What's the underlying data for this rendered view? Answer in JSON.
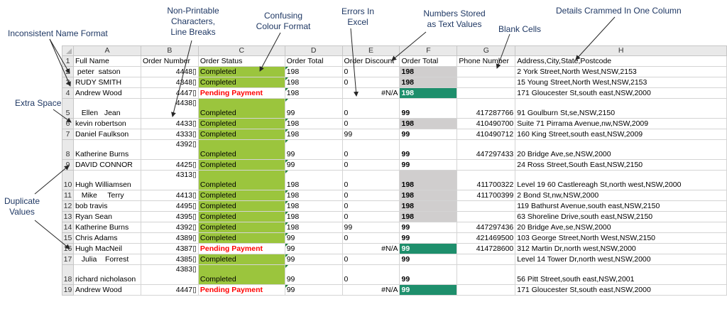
{
  "annotations": {
    "inconsistent_name": "Inconsistent Name Format",
    "non_printable": [
      "Non-Printable",
      "Characters,",
      "Line Breaks"
    ],
    "confusing_colour": [
      "Confusing",
      "Colour Format"
    ],
    "errors_in_excel": [
      "Errors In",
      "Excel"
    ],
    "numbers_as_text": [
      "Numbers Stored",
      "as Text Values"
    ],
    "blank_cells": "Blank Cells",
    "details_crammed": "Details Crammed In One Column",
    "extra_spaces": "Extra Spaces",
    "duplicate_values": [
      "Duplicate",
      "Values"
    ]
  },
  "sheet": {
    "column_letters": [
      "A",
      "B",
      "C",
      "D",
      "E",
      "F",
      "G",
      "H"
    ],
    "header_row_number": "1",
    "headers": [
      "Full Name",
      "Order Number",
      "Order Status",
      "Order Total",
      "Order Discount",
      "Order Total",
      "Phone Number",
      "Address,City,State,Postcode"
    ],
    "rows": [
      {
        "n": "2",
        "name": " peter  satson",
        "order": "4448▯",
        "status": "Completed",
        "total": "198",
        "disc": "0",
        "total2": "198",
        "phone": "",
        "addr": "2 York Street,North West,NSW,2153",
        "style": "grey"
      },
      {
        "n": "3",
        "name": "RUDY SMITH",
        "order": "4348▯",
        "status": "Completed",
        "total": "198",
        "disc": "0",
        "total2": "198",
        "phone": "",
        "addr": "15 Young Street,North West,NSW,2153",
        "style": "grey"
      },
      {
        "n": "4",
        "name": "Andrew Wood",
        "order": "4447▯",
        "status": "Pending Payment",
        "total": "198",
        "disc": "#N/A",
        "total2": "198",
        "phone": "",
        "addr": "171 Gloucester St,south east,NSW,2000",
        "style": "teal"
      },
      {
        "n": "5",
        "name": "   Ellen   Jean",
        "order": "4438▯",
        "status": "Completed",
        "total": "99",
        "disc": "0",
        "total2": "99",
        "phone": "417287766",
        "addr": "91 Goulburn St,se,NSW,2150",
        "style": "white",
        "tall": true
      },
      {
        "n": "6",
        "name": "kevin robertson",
        "order": "   4433▯",
        "status": "Completed",
        "total": "198",
        "disc": "0",
        "total2": "198",
        "phone": "410490700",
        "addr": "Suite 71 Pirrama Avenue,nw,NSW,2009",
        "style": "grey"
      },
      {
        "n": "7",
        "name": "Daniel Faulkson",
        "order": "     4333▯",
        "status": "Completed",
        "total": "198",
        "disc": "99",
        "total2": "99",
        "phone": "410490712",
        "addr": "160 King Street,south east,NSW,2009",
        "style": "white"
      },
      {
        "n": "8",
        "name": "Katherine Burns",
        "order": "4392▯",
        "status": "Completed",
        "total": "99",
        "disc": "0",
        "total2": "99",
        "phone": "447297433",
        "addr": "20 Bridge Ave,se,NSW,2000",
        "style": "white",
        "tall": true
      },
      {
        "n": "9",
        "name": "DAVID CONNOR",
        "order": "   4425▯",
        "status": "Completed",
        "total": "99",
        "disc": "0",
        "total2": "99",
        "phone": "",
        "addr": "24 Ross Street,South East,NSW,2150",
        "style": "white"
      },
      {
        "n": "10",
        "name": "Hugh Williamsen",
        "order": "4313▯",
        "status": "Completed",
        "total": "198",
        "disc": "0",
        "total2": "198",
        "phone": "411700322",
        "addr": "Level 19 60 Castlereagh St,north west,NSW,2000",
        "style": "grey",
        "tall": true
      },
      {
        "n": "11",
        "name": "   Mike     Terry",
        "order": "     4413▯",
        "status": "Completed",
        "total": "198",
        "disc": "0",
        "total2": "198",
        "phone": "411700399",
        "addr": "2 Bond St,nw,NSW,2000",
        "style": "grey"
      },
      {
        "n": "12",
        "name": "bob travis",
        "order": "   4495▯",
        "status": "Completed",
        "total": "198",
        "disc": "0",
        "total2": "198",
        "phone": "",
        "addr": "119 Bathurst Avenue,south east,NSW,2150",
        "style": "grey"
      },
      {
        "n": "13",
        "name": "Ryan Sean",
        "order": "   4395▯",
        "status": "Completed",
        "total": "198",
        "disc": "0",
        "total2": "198",
        "phone": "",
        "addr": "63 Shoreline Drive,south east,NSW,2150",
        "style": "grey"
      },
      {
        "n": "14",
        "name": "Katherine Burns",
        "order": "     4392▯",
        "status": "Completed",
        "total": "198",
        "disc": "99",
        "total2": "99",
        "phone": "447297436",
        "addr": "20 Bridge Ave,se,NSW,2000",
        "style": "white"
      },
      {
        "n": "15",
        "name": "Chris Adams",
        "order": "   4389▯",
        "status": "Completed",
        "total": "99",
        "disc": "0",
        "total2": "99",
        "phone": "421469500",
        "addr": "103 George Street,North West,NSW,2150",
        "style": "white"
      },
      {
        "n": "16",
        "name": "Hugh MacNeil",
        "order": "       4387▯",
        "status": "Pending Payment",
        "total": "99",
        "disc": "#N/A",
        "total2": "99",
        "phone": "414728600",
        "addr": "312 Martin Dr,north west,NSW,2000",
        "style": "teal"
      },
      {
        "n": "17",
        "name": "   Julia    Forrest",
        "order": "   4385▯",
        "status": "Completed",
        "total": "99",
        "disc": "0",
        "total2": "99",
        "phone": "",
        "addr": "Level 14 Tower Dr,north west,NSW,2000",
        "style": "white"
      },
      {
        "n": "18",
        "name": "richard nicholason",
        "order": "4383▯",
        "status": "Completed",
        "total": "99",
        "disc": "0",
        "total2": "99",
        "phone": "",
        "addr": "56 Pitt Street,south east,NSW,2001",
        "style": "white",
        "tall": true
      },
      {
        "n": "19",
        "name": "Andrew Wood",
        "order": "   4447▯",
        "status": "Pending Payment",
        "total": "99",
        "disc": "#N/A",
        "total2": "99",
        "phone": "",
        "addr": "171 Gloucester St,south east,NSW,2000",
        "style": "teal"
      }
    ]
  },
  "colors": {
    "completed": "#9bc53d",
    "pending_text": "#ff0000",
    "highlight_grey": "#d0cece",
    "highlight_teal": "#1e8f6c",
    "annotation_text": "#1f3864"
  }
}
